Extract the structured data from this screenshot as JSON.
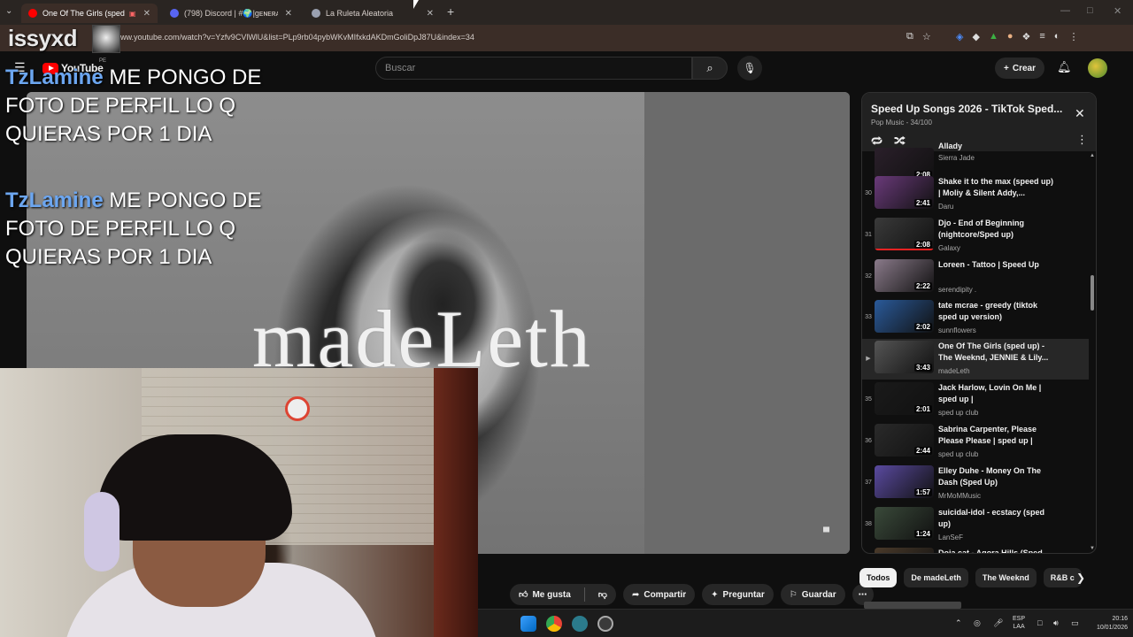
{
  "browser": {
    "tabs": [
      {
        "title": "One Of The Girls (sped up)",
        "active": true
      },
      {
        "title": "(798) Discord | #🌍|ɡᴇɴᴇʀᴀʟ |",
        "active": false
      },
      {
        "title": "La Ruleta Aleatoria",
        "active": false
      }
    ],
    "url": "ww.youtube.com/watch?v=Yzfv9CVlWlU&list=PLp9rb04pybWKvMIfxkdAKDmGoliDpJ87U&index=34"
  },
  "stream": {
    "streamer_name": "issyxd",
    "chat": [
      {
        "user": "TzLamine",
        "text": "ME PONGO DE FOTO DE PERFIL LO Q QUIERAS POR 1 DIA"
      },
      {
        "user": "TzLamine",
        "text": "ME PONGO DE FOTO DE PERFIL LO Q QUIERAS POR 1 DIA"
      }
    ]
  },
  "youtube": {
    "logo_text": "YouTube",
    "country": "PE",
    "search_placeholder": "Buscar",
    "create_label": "Crear"
  },
  "video": {
    "watermark": "madeLeth",
    "actions": {
      "like": "Me gusta",
      "share": "Compartir",
      "ask": "Preguntar",
      "save": "Guardar"
    }
  },
  "playlist": {
    "title": "Speed Up Songs 2026 - TikTok Sped...",
    "subtitle": "Pop Music - 34/100",
    "items": [
      {
        "index": "",
        "title": "Allady",
        "channel": "Sierra Jade",
        "duration": "2:08",
        "thumb": "#2a1f2a",
        "partial": true
      },
      {
        "index": "30",
        "title": "Shake it to the max (speed up) | Moliy & Silent Addy,...",
        "channel": "Daru",
        "duration": "2:41",
        "thumb": "#6a3a7a"
      },
      {
        "index": "31",
        "title": "Djo - End of Beginning (nightcore/Sped up)",
        "channel": "Galaxy",
        "duration": "2:08",
        "thumb": "#3a3a3a",
        "watched": true
      },
      {
        "index": "32",
        "title": "Loreen - Tattoo | Speed Up",
        "channel": "serendipity .",
        "duration": "2:22",
        "thumb": "#8a7a8a"
      },
      {
        "index": "33",
        "title": "tate mcrae - greedy (tiktok sped up version)",
        "channel": "sunnflowers",
        "duration": "2:02",
        "thumb": "#2a5a9a"
      },
      {
        "index": "▶",
        "title": "One Of The Girls (sped up) - The Weeknd, JENNIE & Lily...",
        "channel": "madeLeth",
        "duration": "3:43",
        "thumb": "#555555",
        "current": true
      },
      {
        "index": "35",
        "title": "Jack Harlow, Lovin On Me | sped up |",
        "channel": "sped up club",
        "duration": "2:01",
        "thumb": "#1a1a1a"
      },
      {
        "index": "36",
        "title": "Sabrina Carpenter, Please Please Please | sped up |",
        "channel": "sped up club",
        "duration": "2:44",
        "thumb": "#2a2a2a"
      },
      {
        "index": "37",
        "title": "Elley Duhe - Money On The Dash (Sped Up)",
        "channel": "MrMoMMusic",
        "duration": "1:57",
        "thumb": "#5a4aa0"
      },
      {
        "index": "38",
        "title": "suicidal-idol - ecstacy (sped up)",
        "channel": "LanSeF",
        "duration": "1:24",
        "thumb": "#3a4a3a"
      },
      {
        "index": "",
        "title": "Doja cat - Agora Hills (Sped",
        "channel": "",
        "duration": "",
        "thumb": "#4a3a2a",
        "partial": true
      }
    ]
  },
  "chips": [
    "Todos",
    "De madeLeth",
    "The Weeknd",
    "R&B c"
  ],
  "taskbar": {
    "lang": "ESP",
    "lang2": "LAA",
    "time": "20:16",
    "date": "10/01/2026"
  }
}
